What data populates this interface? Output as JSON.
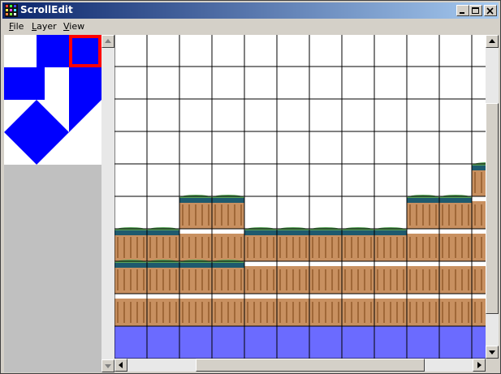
{
  "window": {
    "title": "ScrollEdit",
    "buttons": {
      "minimize": "minimize-icon",
      "maximize": "maximize-icon",
      "close": "close-icon"
    }
  },
  "menu": [
    {
      "label": "File",
      "accel": "F",
      "rest": "ile"
    },
    {
      "label": "Layer",
      "accel": "L",
      "rest": "ayer"
    },
    {
      "label": "View",
      "accel": "V",
      "rest": "iew"
    }
  ],
  "colors": {
    "accent_blue": "#0000ff",
    "selection_red": "#ff0000",
    "water": "#6b6bff",
    "grass": "#5aa55a",
    "log": "#c89060",
    "grid": "#000000"
  },
  "map": {
    "columns": 12,
    "rows": 10,
    "water_row": 9,
    "column_log_tops": [
      6,
      6,
      5,
      5,
      6,
      6,
      6,
      6,
      6,
      5,
      5,
      4
    ],
    "second_tier_columns": [
      0,
      1,
      2,
      3
    ]
  }
}
